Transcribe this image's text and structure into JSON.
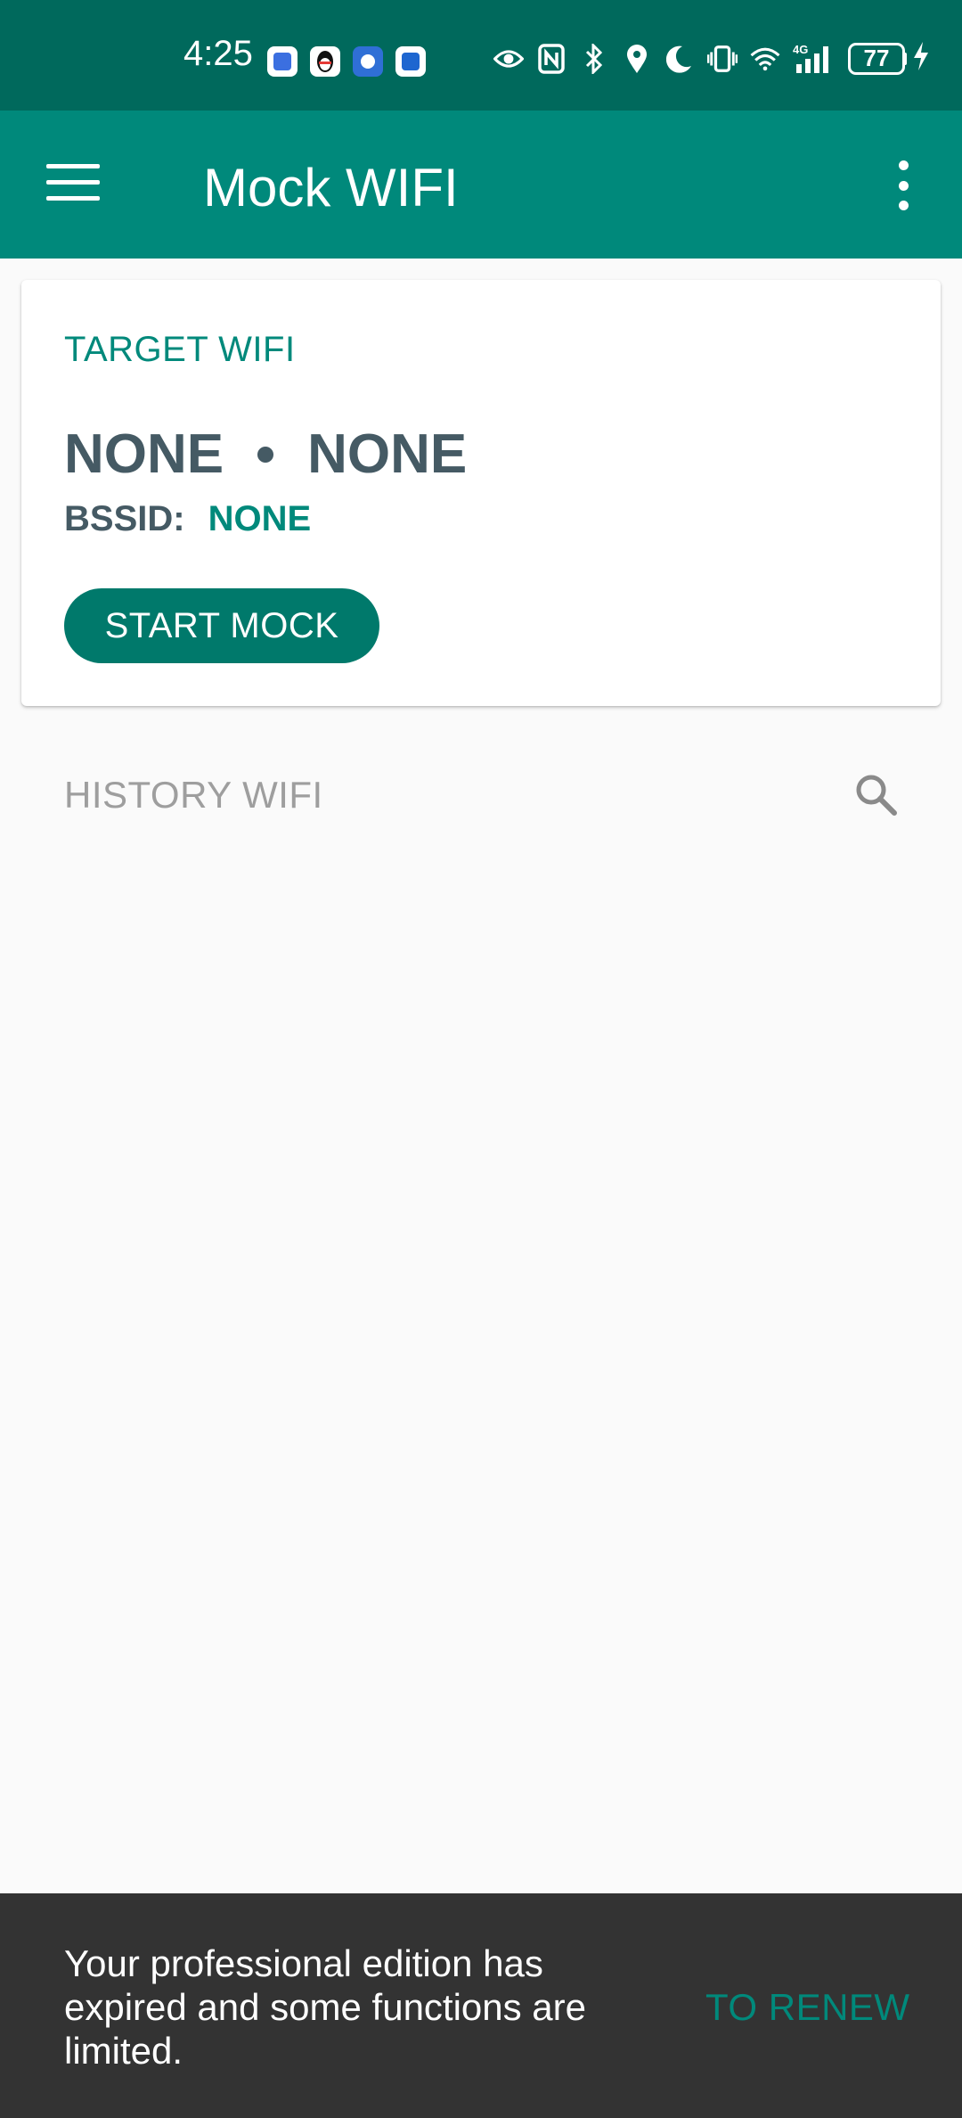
{
  "status_bar": {
    "time": "4:25",
    "notification_icons": [
      "shield-app-icon",
      "qq-penguin-icon",
      "browser-app-icon",
      "mail-app-icon"
    ],
    "system_icons": [
      "eye-icon",
      "nfc-icon",
      "bluetooth-icon",
      "location-icon",
      "do-not-disturb-moon-icon",
      "vibrate-icon",
      "wifi-icon",
      "cellular-4g-icon"
    ],
    "network_type": "4G",
    "battery_level": "77",
    "charging": true
  },
  "app_bar": {
    "title": "Mock WIFI",
    "color": "#00897b"
  },
  "target_card": {
    "section_label": "TARGET WIFI",
    "ssid": "NONE",
    "security": "NONE",
    "bssid_label": "BSSID:",
    "bssid_value": "NONE",
    "start_button_label": "START MOCK"
  },
  "history": {
    "section_label": "HISTORY WIFI",
    "items": []
  },
  "snackbar": {
    "message": "Your professional edition has expired and some functions are limited.",
    "action_label": "TO RENEW"
  },
  "colors": {
    "status_bar": "#00695c",
    "accent": "#00897b",
    "text_primary": "#455a64",
    "snackbar_bg": "#333333"
  }
}
